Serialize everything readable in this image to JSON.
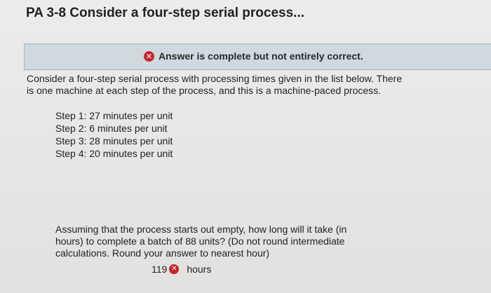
{
  "header": {
    "title": "PA 3-8 Consider a four-step serial process..."
  },
  "status": {
    "icon": "close-icon",
    "text": "Answer is complete but not entirely correct.",
    "icon_color": "#c8232f",
    "banner_color": "#cfd9df"
  },
  "problem": {
    "intro": "Consider a four-step serial process with processing times given in the list below. There is one machine at each step of the process, and this is a machine-paced process.",
    "steps": [
      {
        "label": "Step 1: 27 minutes per unit"
      },
      {
        "label": "Step 2: 6 minutes per unit"
      },
      {
        "label": "Step 3: 28 minutes per unit"
      },
      {
        "label": "Step 4: 20 minutes per unit"
      }
    ],
    "question": "Assuming that the process starts out empty, how long will it take (in hours) to complete a batch of 88 units? (Do not round intermediate calculations. Round your answer to nearest hour)"
  },
  "answer": {
    "value": "119",
    "unit": "hours",
    "status_icon": "close-icon"
  }
}
